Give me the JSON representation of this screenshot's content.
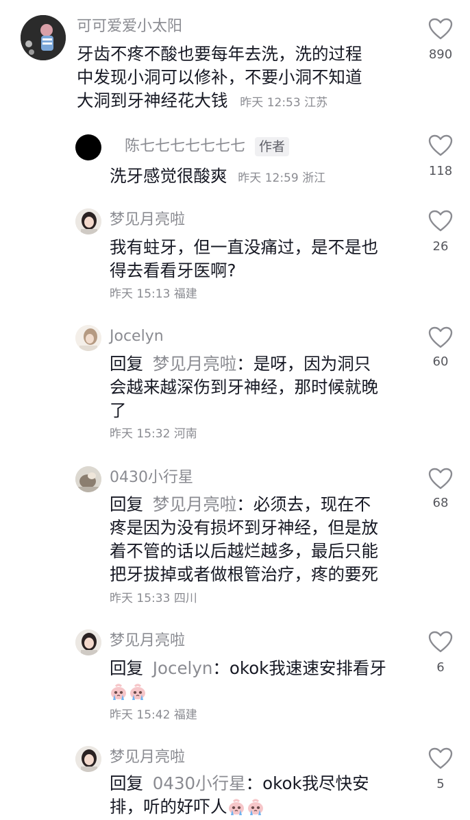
{
  "comments": [
    {
      "user": "可可爱爱小太阳",
      "lines": [
        "牙齿不疼不酸也要每年去洗，洗的过程",
        "中发现小洞可以修补，不要小洞不知道",
        "大洞到牙神经花大钱"
      ],
      "time": "昨天 12:53",
      "location": "江苏",
      "likes": "890"
    },
    {
      "user": "陈七七七七七七七",
      "badge": "作者",
      "text": "洗牙感觉很酸爽",
      "time": "昨天 12:59",
      "location": "浙江",
      "likes": "118"
    },
    {
      "user": "梦见月亮啦",
      "lines": [
        "我有蛀牙，但一直没痛过，是不是也",
        "得去看看牙医啊?"
      ],
      "time": "昨天 15:13",
      "location": "福建",
      "likes": "26"
    },
    {
      "user": "Jocelyn",
      "reply_word": "回复",
      "reply_target": "梦见月亮啦",
      "first_line_rest": "：是呀，因为洞只",
      "lines": [
        "会越来越深伤到牙神经，那时候就晚",
        "了"
      ],
      "time": "昨天 15:32",
      "location": "河南",
      "likes": "60"
    },
    {
      "user": "0430小行星",
      "reply_word": "回复",
      "reply_target": "梦见月亮啦",
      "first_line_rest": "：必须去，现在不",
      "lines": [
        "疼是因为没有损坏到牙神经，但是放",
        "着不管的话以后越烂越多，最后只能",
        "把牙拔掉或者做根管治疗，疼的要死"
      ],
      "time": "昨天 15:33",
      "location": "四川",
      "likes": "68"
    },
    {
      "user": "梦见月亮啦",
      "reply_word": "回复",
      "reply_target": "Jocelyn",
      "first_line_rest": "：okok我速速安排看牙",
      "emoji": "crying-emoji",
      "time": "昨天 15:42",
      "location": "福建",
      "likes": "6"
    },
    {
      "user": "梦见月亮啦",
      "reply_word": "回复",
      "reply_target": "0430小行星",
      "first_line_rest": "：okok我尽快安",
      "second_line": "排，听的好吓人",
      "emoji": "crying-emoji",
      "likes": "5"
    }
  ],
  "colors": {
    "username": "#8a8b91",
    "text": "#161823",
    "meta": "#8a8b91",
    "like_icon": "#8a8b91"
  }
}
